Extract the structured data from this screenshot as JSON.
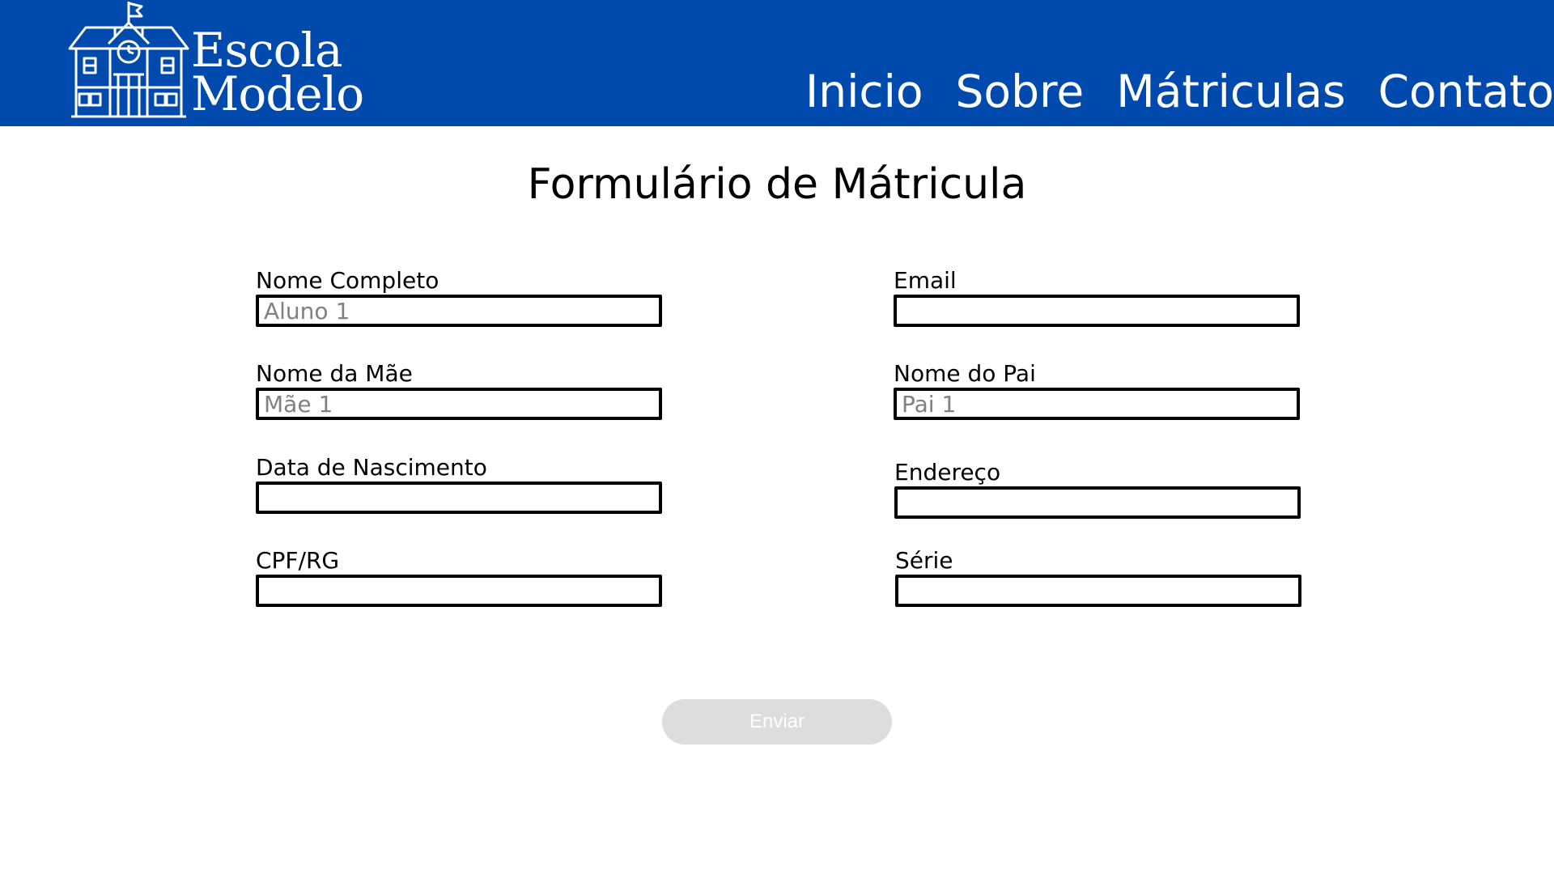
{
  "header": {
    "logo": {
      "line1": "Escola",
      "line2": "Modelo"
    },
    "nav": [
      {
        "label": "Inicio"
      },
      {
        "label": "Sobre"
      },
      {
        "label": "Mátriculas"
      },
      {
        "label": "Contato"
      }
    ],
    "colors": {
      "background": "#004aad",
      "text": "#ffffff"
    }
  },
  "page_title": "Formulário de Mátricula",
  "form": {
    "nome_completo": {
      "label": "Nome Completo",
      "placeholder": "Aluno 1",
      "value": ""
    },
    "email": {
      "label": "Email",
      "placeholder": "",
      "value": ""
    },
    "nome_mae": {
      "label": "Nome da Mãe",
      "placeholder": "Mãe 1",
      "value": ""
    },
    "nome_pai": {
      "label": "Nome do Pai",
      "placeholder": "Pai 1",
      "value": ""
    },
    "data_nascimento": {
      "label": "Data de Nascimento",
      "placeholder": "",
      "value": ""
    },
    "endereco": {
      "label": "Endereço",
      "placeholder": "",
      "value": ""
    },
    "cpf_rg": {
      "label": "CPF/RG",
      "placeholder": "",
      "value": ""
    },
    "serie": {
      "label": "Série",
      "placeholder": "",
      "value": ""
    },
    "submit_label": "Enviar"
  },
  "icons": {
    "logo": "school-building-icon"
  }
}
